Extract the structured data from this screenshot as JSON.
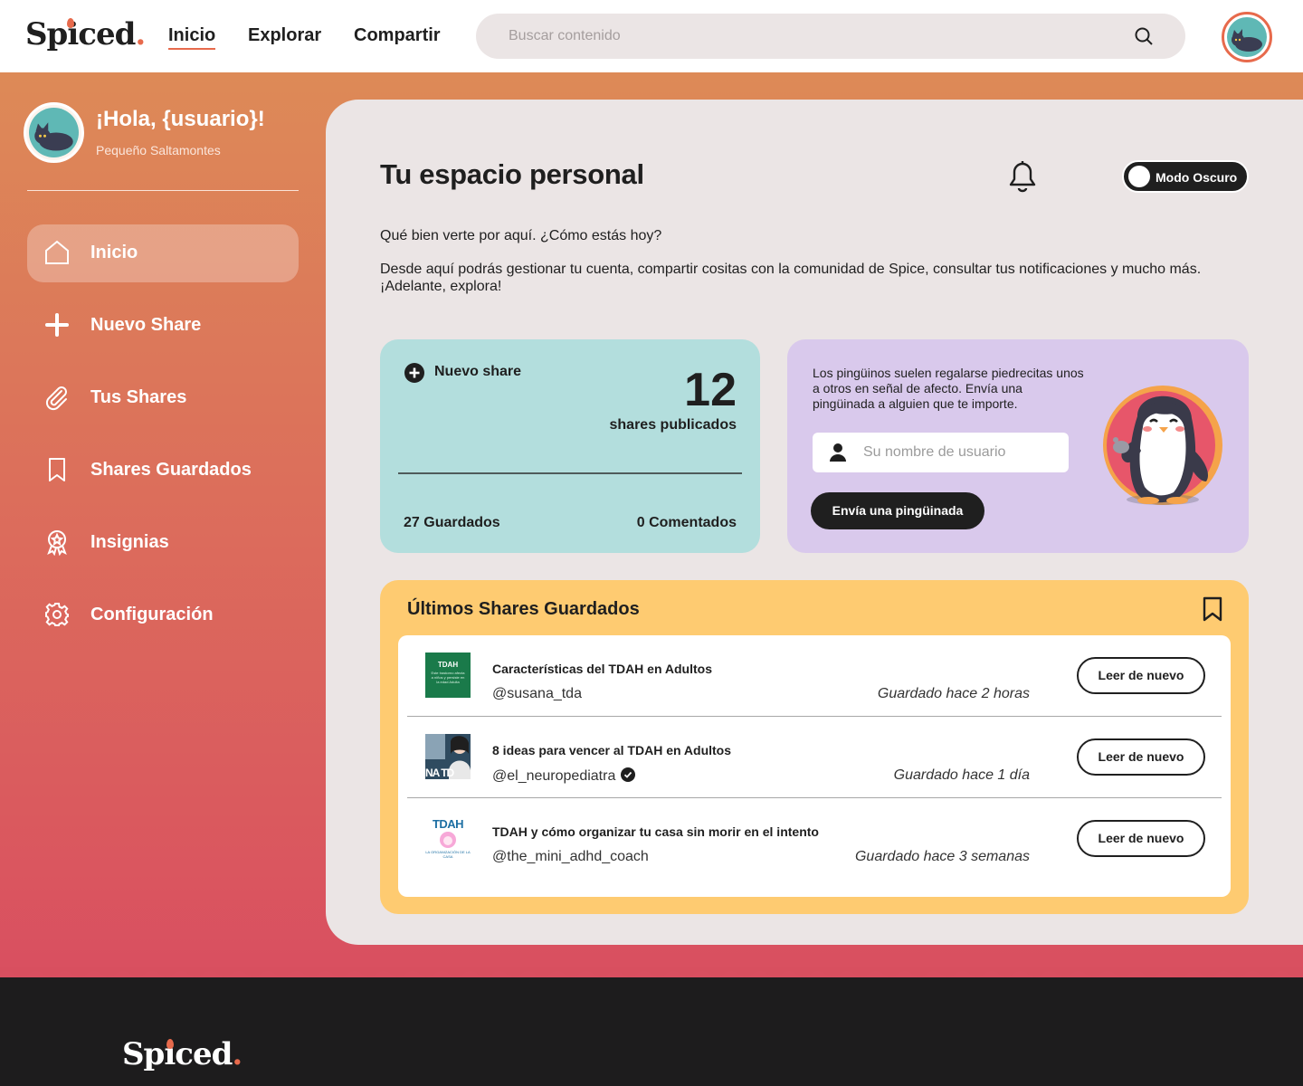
{
  "header": {
    "logo": "Spiced",
    "nav": [
      {
        "label": "Inicio",
        "active": true
      },
      {
        "label": "Explorar",
        "active": false
      },
      {
        "label": "Compartir",
        "active": false
      }
    ],
    "search_placeholder": "Buscar contenido",
    "avatar_icon": "cat-avatar-icon"
  },
  "sidebar": {
    "greeting": "¡Hola, {usuario}!",
    "rank": "Pequeño Saltamontes",
    "items": [
      {
        "label": "Inicio",
        "icon": "home-icon",
        "active": true
      },
      {
        "label": "Nuevo Share",
        "icon": "plus-icon",
        "active": false
      },
      {
        "label": "Tus Shares",
        "icon": "paperclip-icon",
        "active": false
      },
      {
        "label": "Shares Guardados",
        "icon": "bookmark-icon",
        "active": false
      },
      {
        "label": "Insignias",
        "icon": "badge-icon",
        "active": false
      },
      {
        "label": "Configuración",
        "icon": "gear-icon",
        "active": false
      }
    ]
  },
  "main": {
    "title": "Tu espacio personal",
    "dark_mode_label": "Modo Oscuro",
    "intro_1": "Qué bien verte por aquí. ¿Cómo estás hoy?",
    "intro_2": "Desde aquí podrás gestionar tu cuenta, compartir cositas con la comunidad de Spice, consultar tus notificaciones y mucho más. ¡Adelante, explora!"
  },
  "stats": {
    "new_share_label": "Nuevo share",
    "published_count": "12",
    "published_label": "shares publicados",
    "saved_label": "27 Guardados",
    "commented_label": "0 Comentados"
  },
  "penguin": {
    "description": "Los pingüinos suelen regalarse piedrecitas unos a otros en señal de afecto. Envía una pingüinada a alguien que te importe.",
    "username_placeholder": "Su nombre de usuario",
    "send_label": "Envía una pingüinada"
  },
  "saved": {
    "title": "Últimos Shares Guardados",
    "read_again_label": "Leer de nuevo",
    "items": [
      {
        "title": "Características del TDAH en Adultos",
        "handle": "@susana_tda",
        "verified": false,
        "when": "Guardado hace 2 horas",
        "thumb_title": "TDAH",
        "thumb_text": "Este trastorno afecta a niños y persiste en la edad Adulta"
      },
      {
        "title": "8 ideas para vencer al TDAH en Adultos",
        "handle": "@el_neuropediatra",
        "verified": true,
        "when": "Guardado hace 1 día",
        "thumb_text": "NA TD"
      },
      {
        "title": "TDAH y cómo organizar tu casa sin morir en el intento",
        "handle": "@the_mini_adhd_coach",
        "verified": false,
        "when": "Guardado hace 3 semanas",
        "thumb_title": "TDAH",
        "thumb_text": "LA ORGANIZACIÓN DE LA CASA"
      }
    ]
  },
  "footer": {
    "logo": "Spiced"
  },
  "colors": {
    "accent": "#e76a4c",
    "teal_card": "#b3dedd",
    "purple_card": "#d9c9ec",
    "yellow_card": "#fecb71",
    "dark": "#1f1f1f"
  }
}
